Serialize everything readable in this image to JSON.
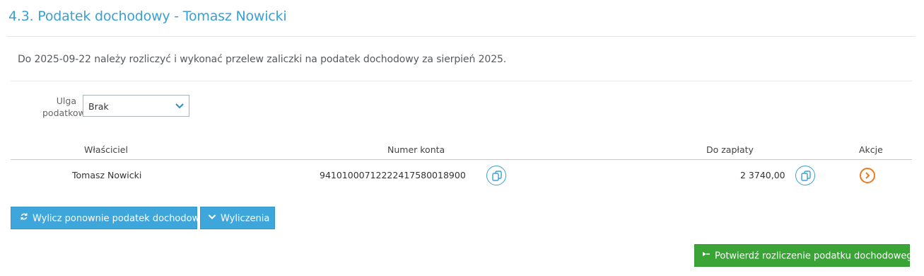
{
  "header": {
    "title": "4.3. Podatek dochodowy - Tomasz Nowicki"
  },
  "notice": {
    "text": "Do 2025-09-22 należy rozliczyć i wykonać przelew zaliczki na podatek dochodowy za sierpień 2025."
  },
  "relief": {
    "label_line1": "Ulga",
    "label_line2": "podatkowa",
    "selected": "Brak"
  },
  "table": {
    "headers": {
      "owner": "Właściciel",
      "account": "Numer konta",
      "amount": "Do zapłaty",
      "actions": "Akcje"
    },
    "rows": [
      {
        "owner": "Tomasz Nowicki",
        "account": "94101000712222417580018900",
        "amount": "2 3740,00"
      }
    ]
  },
  "buttons": {
    "recalculate": "Wylicz ponownie podatek dochodowy",
    "calculations": "Wyliczenia",
    "confirm": "Potwierdź rozliczenie podatku dochodowego"
  },
  "colors": {
    "accent": "#3b9fd4",
    "button_blue": "#3fa6dc",
    "button_green": "#3aa536",
    "action_orange": "#f07a1e"
  },
  "icons": {
    "select": "chevron-down-icon",
    "copy": "copy-icon",
    "action": "chevron-right-circle-icon",
    "recalculate": "refresh-icon",
    "calculations": "chevron-down-icon",
    "confirm": "forward-icon"
  }
}
